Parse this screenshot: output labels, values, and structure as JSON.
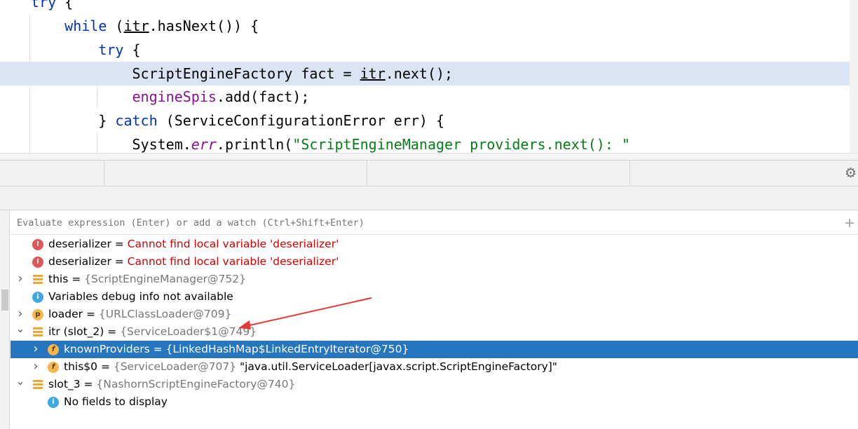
{
  "editor": {
    "lines": [
      {
        "indent": "",
        "parts": [
          {
            "t": "try",
            "c": "kw"
          },
          {
            "t": " {",
            "c": ""
          }
        ]
      },
      {
        "indent": "    ",
        "parts": [
          {
            "t": "while",
            "c": "kw"
          },
          {
            "t": " (",
            "c": ""
          },
          {
            "t": "itr",
            "c": "under"
          },
          {
            "t": ".hasNext()) {",
            "c": ""
          }
        ]
      },
      {
        "indent": "        ",
        "parts": [
          {
            "t": "try",
            "c": "kw"
          },
          {
            "t": " {",
            "c": ""
          }
        ]
      },
      {
        "indent": "            ",
        "parts": [
          {
            "t": "ScriptEngineFactory fact = ",
            "c": ""
          },
          {
            "t": "itr",
            "c": "under"
          },
          {
            "t": ".next();",
            "c": ""
          }
        ]
      },
      {
        "indent": "            ",
        "parts": [
          {
            "t": "engineSpis",
            "c": "fld"
          },
          {
            "t": ".add(fact);",
            "c": ""
          }
        ]
      },
      {
        "indent": "        ",
        "parts": [
          {
            "t": "} ",
            "c": ""
          },
          {
            "t": "catch",
            "c": "kw"
          },
          {
            "t": " (ServiceConfigurationError err) {",
            "c": ""
          }
        ]
      },
      {
        "indent": "            ",
        "parts": [
          {
            "t": "System.",
            "c": ""
          },
          {
            "t": "err",
            "c": "fld ital"
          },
          {
            "t": ".println(",
            "c": ""
          },
          {
            "t": "\"ScriptEngineManager providers.next(): \"",
            "c": "str"
          }
        ]
      }
    ]
  },
  "debugger": {
    "watch_placeholder": "Evaluate expression (Enter) or add a watch (Ctrl+Shift+Enter)",
    "toolbar_icons": [
      "gear-icon",
      "add-watch-icon"
    ],
    "variables": [
      {
        "icon": "error",
        "name": "deserializer",
        "eq": " = ",
        "value": "Cannot find local variable 'deserializer'",
        "value_style": "error"
      },
      {
        "icon": "error",
        "name": "deserializer",
        "eq": " = ",
        "value": "Cannot find local variable 'deserializer'",
        "value_style": "error"
      },
      {
        "icon": "object",
        "name": "this",
        "eq": " = ",
        "value": "{ScriptEngineManager@752}",
        "value_style": "ref",
        "expand": "collapsed"
      },
      {
        "icon": "info",
        "name": "Variables debug info not available",
        "eq": "",
        "value": "",
        "value_style": ""
      },
      {
        "icon": "param",
        "name": "loader",
        "eq": " = ",
        "value": "{URLClassLoader@709}",
        "value_style": "ref",
        "expand": "collapsed"
      },
      {
        "icon": "object",
        "name": "itr (slot_2)",
        "eq": " = ",
        "value": "{ServiceLoader$1@749}",
        "value_style": "ref",
        "expand": "expanded"
      },
      {
        "icon": "field",
        "name": "knownProviders",
        "eq": " = ",
        "value": "{LinkedHashMap$LinkedEntryIterator@750}",
        "value_style": "ref",
        "expand": "collapsed",
        "selected": true,
        "level": 1
      },
      {
        "icon": "field-locked",
        "name": "this$0",
        "eq": " = ",
        "value": "{ServiceLoader@707}",
        "value_style": "ref",
        "extra": " \"java.util.ServiceLoader[javax.script.ScriptEngineFactory]\"",
        "expand": "collapsed",
        "level": 1
      },
      {
        "icon": "object",
        "name": "slot_3",
        "eq": " = ",
        "value": "{NashornScriptEngineFactory@740}",
        "value_style": "ref",
        "expand": "expanded"
      },
      {
        "icon": "info",
        "name": "No fields to display",
        "eq": "",
        "value": "",
        "value_style": "",
        "level": 1
      }
    ]
  },
  "colors": {
    "selection": "#2675bf",
    "highlight_line": "#dbe4f5",
    "error_text": "#d40000",
    "annotation_arrow": "#e53935"
  }
}
